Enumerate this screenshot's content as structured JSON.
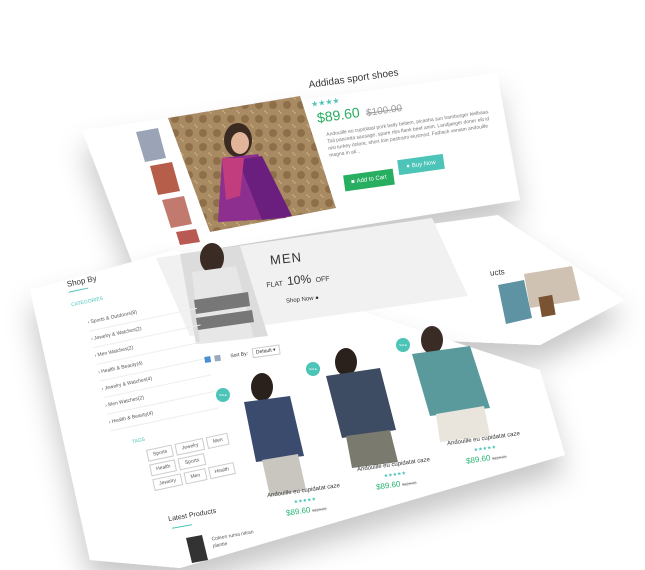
{
  "product": {
    "title": "Addidas sport shoes",
    "rating": "★★★★",
    "price": "$89.60",
    "old_price": "$100.00",
    "description": "Andouille eu cupidatat pork belly beliem, picanha sun hamburger kielbasa. Tail pancetta sausage, spare ribs flank beef anim. Landjaeger doner elit id nisi turkey dolore, short loin pastrami eiusmod. Fatback veniam andouille magna in ali..."
  },
  "buttons": {
    "add_to_cart": "Add to Cart",
    "buy_now": "Buy Now"
  },
  "banner": {
    "title": "MEN",
    "flat": "FLAT",
    "percent": "10%",
    "off": "OFF",
    "shop_now": "Shop Now"
  },
  "side_panel": {
    "title": "ucts"
  },
  "sidebar": {
    "title": "Shop By",
    "categories_label": "CATEGORIES",
    "categories": [
      "Sports & Outdoors(8)",
      "Jewelry & Watches(2)",
      "Men Watches(2)",
      "Health & Beauty(4)",
      "Jewelry & Watches(4)",
      "Men Watches(2)",
      "Health & Beauty(4)"
    ],
    "tags_label": "TAGS",
    "tags": [
      "Sports",
      "Jewelry",
      "Men",
      "Health",
      "Sports",
      "Jewelry",
      "Men",
      "Health"
    ]
  },
  "toolbar": {
    "sort_by": "Sort By:",
    "sort_value": "Default"
  },
  "products": [
    {
      "badge": "SALE",
      "name": "Andouille eu cupidatat caze",
      "rating": "★★★★★",
      "price": "$89.60",
      "old": "$120.00",
      "colors": {
        "shirt": "#3b4b6e",
        "pants": "#c9c6c0"
      }
    },
    {
      "badge": "SALE",
      "name": "Andouille eu cupidatat caze",
      "rating": "★★★★★",
      "price": "$89.60",
      "old": "$120.00",
      "colors": {
        "shirt": "#3d4b63",
        "pants": "#7b7a6e"
      }
    },
    {
      "badge": "SALE",
      "name": "Andouille eu cupidatat caze",
      "rating": "★★★★★",
      "price": "$89.60",
      "old": "$120.00",
      "colors": {
        "shirt": "#5a9a9c",
        "pants": "#e9e5dc"
      }
    }
  ],
  "latest": {
    "title": "Latest Products",
    "item": "Coleen ruma nitran plantie"
  },
  "colors": {
    "accent": "#4cc4b7",
    "green": "#27ae60",
    "price": "#2bb673",
    "dark": "#333333"
  }
}
